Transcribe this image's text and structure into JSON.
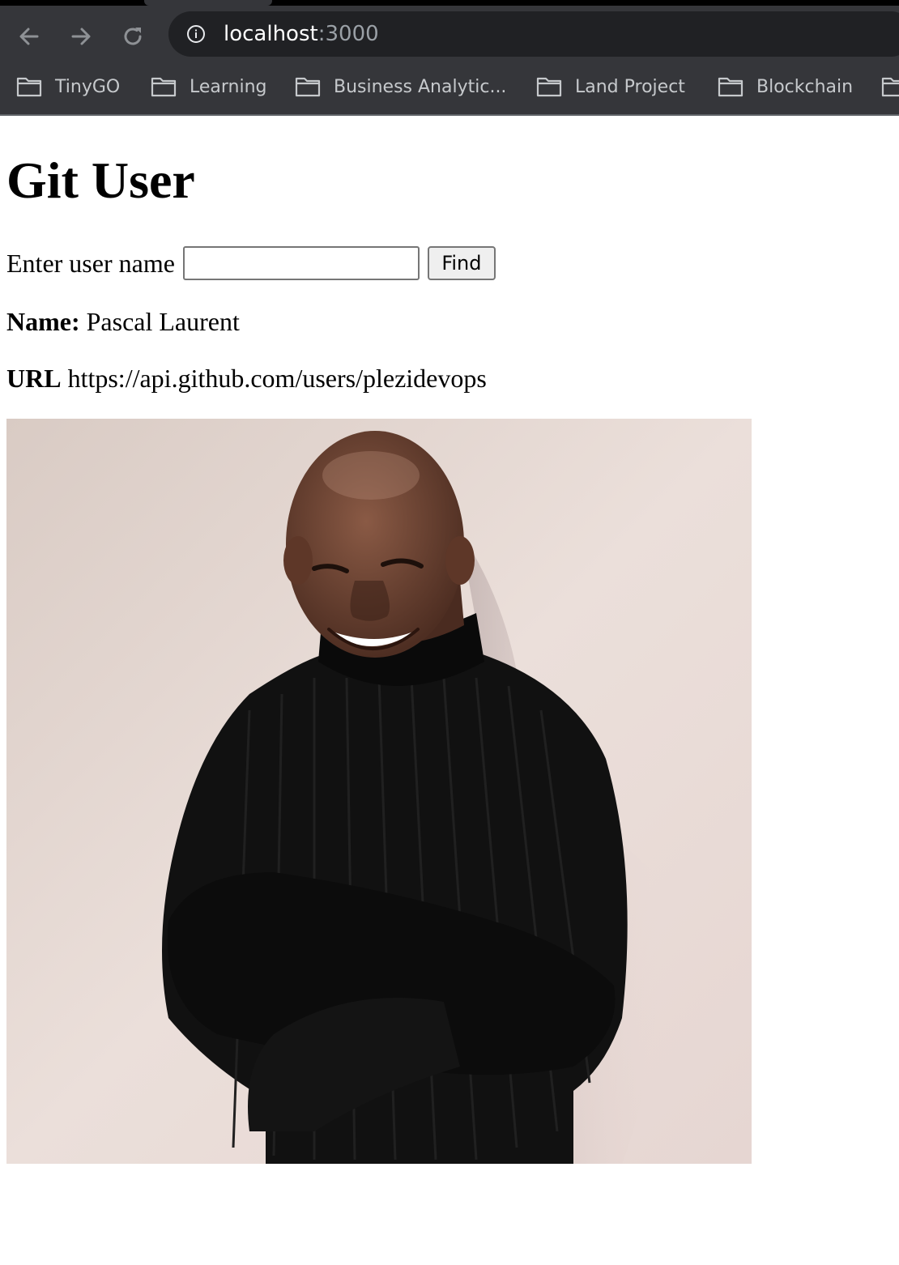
{
  "browser": {
    "url_host": "localhost",
    "url_port": ":3000",
    "bookmarks": [
      {
        "label": "TinyGO",
        "icon": "folder-icon"
      },
      {
        "label": "Learning",
        "icon": "folder-icon"
      },
      {
        "label": "Business Analytic...",
        "icon": "folder-icon"
      },
      {
        "label": "Land Project",
        "icon": "folder-icon"
      },
      {
        "label": "Blockchain",
        "icon": "folder-icon"
      },
      {
        "label": "",
        "icon": "folder-icon"
      }
    ],
    "icons": {
      "back": "back-arrow-icon",
      "forward": "forward-arrow-icon",
      "reload": "reload-icon",
      "site_info": "info-icon"
    },
    "colors": {
      "chrome": "#35363a",
      "omnibox": "#202124"
    }
  },
  "page": {
    "title": "Git User",
    "search": {
      "label": "Enter user name",
      "value": "",
      "placeholder": "",
      "button_label": "Find"
    },
    "user": {
      "name_label": "Name:",
      "name": "Pascal Laurent",
      "url_label": "URL",
      "url": "https://api.github.com/users/plezidevops"
    }
  }
}
